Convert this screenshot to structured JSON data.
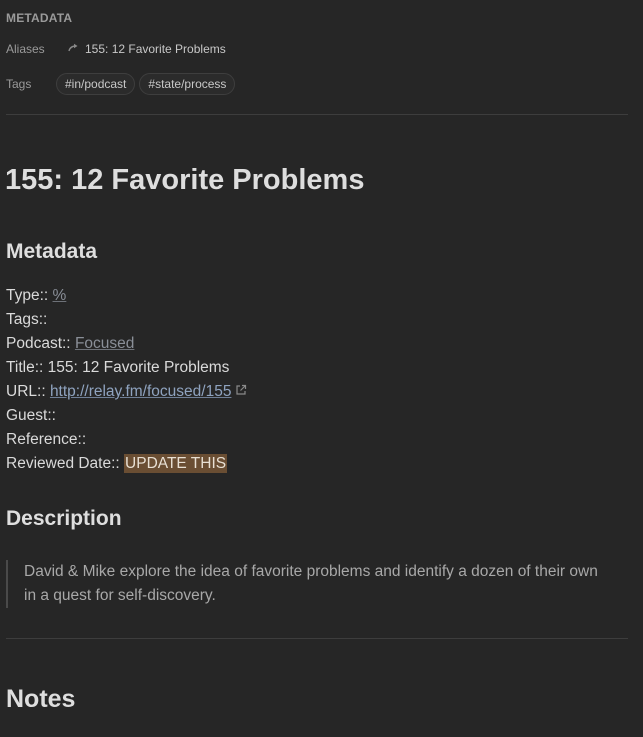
{
  "properties": {
    "heading": "METADATA",
    "aliases_key": "Aliases",
    "alias_value": "155: 12 Favorite Problems",
    "tags_key": "Tags",
    "tags": [
      "#in/podcast",
      "#state/process"
    ]
  },
  "document": {
    "title": "155: 12 Favorite Problems",
    "metadata_heading": "Metadata",
    "fields": {
      "type_key": "Type::",
      "type_value": "%",
      "tags_key": "Tags::",
      "podcast_key": "Podcast::",
      "podcast_value": "Focused",
      "title_key": "Title::",
      "title_value": "155: 12 Favorite Problems",
      "url_key": "URL::",
      "url_value": "http://relay.fm/focused/155",
      "guest_key": "Guest::",
      "reference_key": "Reference::",
      "reviewed_key": "Reviewed Date::",
      "reviewed_value": "UPDATE THIS"
    },
    "description_heading": "Description",
    "description_lines": [
      "David & Mike explore the idea of favorite problems and identify a dozen of their own",
      "in a quest for self-discovery."
    ],
    "notes_heading": "Notes"
  },
  "colors": {
    "background": "#262626",
    "highlight": "#6a4e33",
    "external_link": "#8fa3bf"
  }
}
